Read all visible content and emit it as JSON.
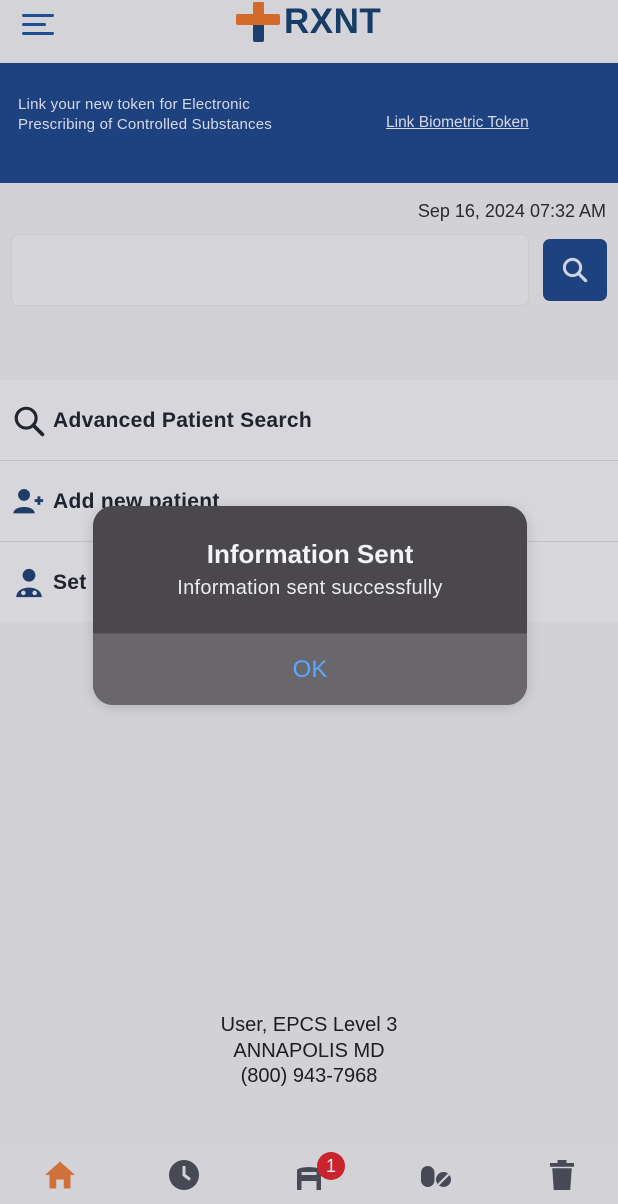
{
  "app": {
    "logo_text": "RXNT"
  },
  "banner": {
    "message": "Link your new token for Electronic Prescribing of Controlled Substances",
    "link_label": "Link Biometric Token"
  },
  "datetime": "Sep 16, 2024 07:32 AM",
  "search": {
    "placeholder": "",
    "value": ""
  },
  "menu": {
    "items": [
      {
        "label": "Advanced Patient Search",
        "icon": "magnifier-icon"
      },
      {
        "label": "Add new patient",
        "icon": "add-person-icon"
      },
      {
        "label": "Set",
        "icon": "doctor-icon"
      }
    ]
  },
  "footer": {
    "user_line": "User, EPCS Level 3",
    "location": "ANNAPOLIS MD",
    "phone": "(800) 943-7968"
  },
  "bottom_nav": {
    "items": [
      "home-icon",
      "clock-icon",
      "waiting-room-icon",
      "pills-icon",
      "trash-icon"
    ],
    "badge_count": "1"
  },
  "dialog": {
    "title": "Information Sent",
    "message": "Information sent successfully",
    "ok_label": "OK"
  },
  "colors": {
    "brand_blue": "#1e4280",
    "brand_orange": "#d46a2a",
    "dialog_link": "#5aa7ff",
    "badge_red": "#c9242e"
  }
}
